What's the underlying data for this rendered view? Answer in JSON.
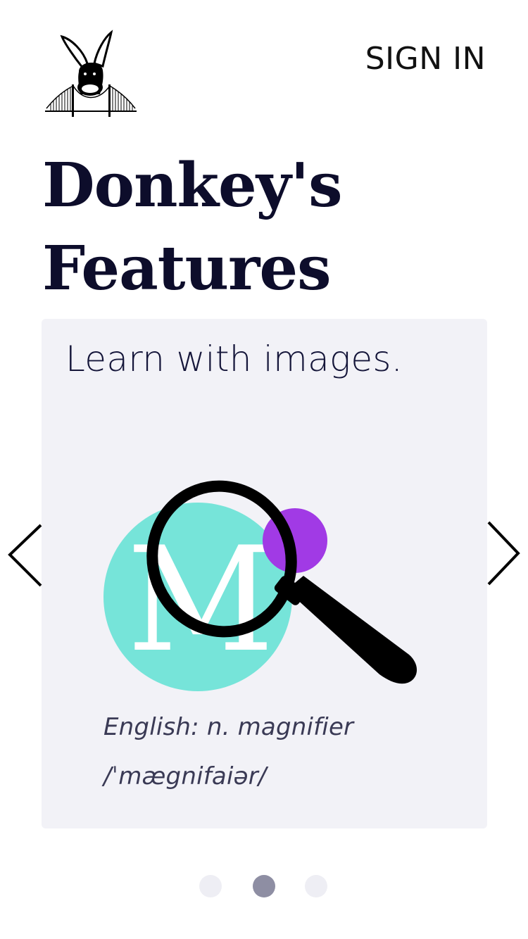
{
  "header": {
    "logo_icon": "donkey-logo-icon",
    "sign_in_label": "SIGN IN"
  },
  "page": {
    "title_line1": "Donkey's",
    "title_line2": "Features"
  },
  "carousel": {
    "heading": "Learn with images.",
    "illustration": {
      "letter": "M",
      "circle_color": "#76e4d9",
      "dot_color": "#a13ae5",
      "icon": "magnifier-icon"
    },
    "caption_word": "English: n. magnifier",
    "caption_ipa": "/ˈmægnifaiər/",
    "prev_icon": "chevron-left-icon",
    "next_icon": "chevron-right-icon",
    "active_slide": 2,
    "slide_count": 3
  },
  "colors": {
    "title": "#0d0d2b",
    "card_bg": "#f2f2f7",
    "dot_active": "#8e8ea3",
    "dot_inactive": "#eeeef4"
  }
}
